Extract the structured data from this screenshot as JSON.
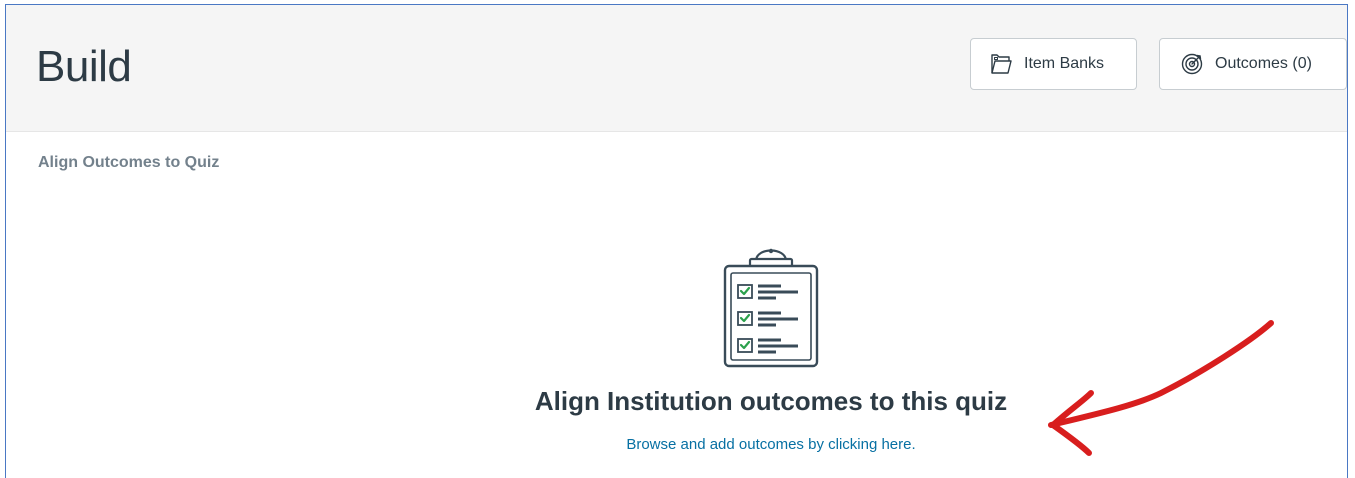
{
  "header": {
    "title": "Build",
    "item_banks_label": "Item Banks",
    "item_banks_icon": "folder-icon",
    "outcomes_label": "Outcomes (0)",
    "outcomes_icon": "target-icon"
  },
  "main": {
    "section_label": "Align Outcomes to Quiz",
    "empty_state": {
      "illustration": "clipboard-checklist-icon",
      "title": "Align Institution outcomes to this quiz",
      "link_text": "Browse and add outcomes by clicking here."
    }
  },
  "annotation": {
    "arrow_color": "#d81e1e"
  },
  "colors": {
    "header_bg": "#f5f5f5",
    "text_dark": "#2d3b45",
    "text_muted": "#73818c",
    "link": "#0770a3",
    "checkbox_green": "#2ba14c"
  }
}
